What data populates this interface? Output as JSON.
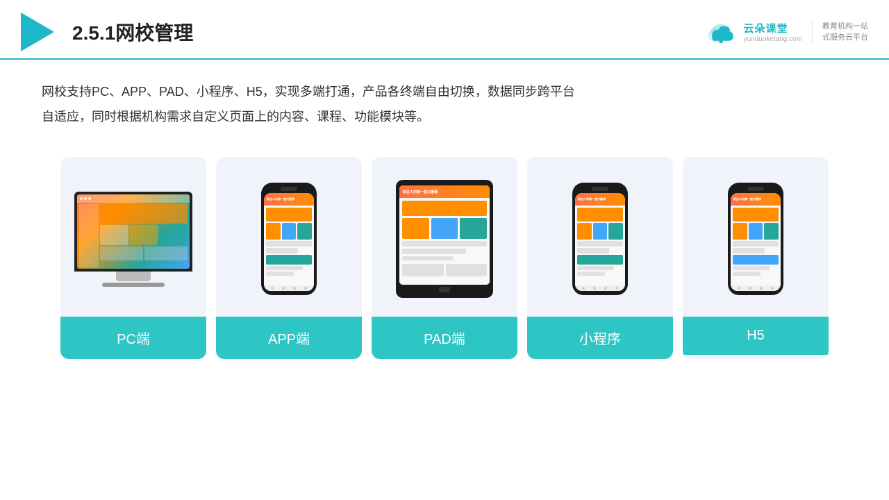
{
  "header": {
    "title": "2.5.1网校管理",
    "brand_name": "云朵课堂",
    "brand_url": "yunduoketang.com",
    "brand_slogan": "教育机构一站\n式服务云平台"
  },
  "description": {
    "text": "网校支持PC、APP、PAD、小程序、H5，实现多端打通，产品各终端自由切换，数据同步跨平台自适应，同时根据机构需求自定义页面上的内容、课程、功能模块等。"
  },
  "cards": [
    {
      "id": "pc",
      "label": "PC端"
    },
    {
      "id": "app",
      "label": "APP端"
    },
    {
      "id": "pad",
      "label": "PAD端"
    },
    {
      "id": "miniprogram",
      "label": "小程序"
    },
    {
      "id": "h5",
      "label": "H5"
    }
  ]
}
